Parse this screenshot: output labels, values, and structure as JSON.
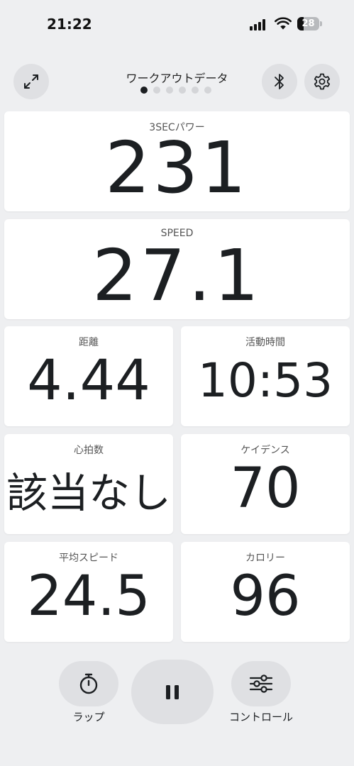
{
  "status_bar": {
    "time": "21:22",
    "battery_level": "28",
    "battery_fraction": 0.28
  },
  "header": {
    "title": "ワークアウトデータ",
    "page_count": 6,
    "active_page": 0,
    "left_icon": "expand-arrows-icon",
    "right_icons": [
      "bluetooth-icon",
      "gear-icon"
    ]
  },
  "metrics": {
    "power": {
      "label": "3SECパワー",
      "value": "231"
    },
    "speed": {
      "label": "SPEED",
      "value": "27.1"
    },
    "distance": {
      "label": "距離",
      "value": "4.44"
    },
    "duration": {
      "label": "活動時間",
      "value": "10:53"
    },
    "heart_rate": {
      "label": "心拍数",
      "value": "該当なし"
    },
    "cadence": {
      "label": "ケイデンス",
      "value": "70"
    },
    "avg_speed": {
      "label": "平均スピード",
      "value": "24.5"
    },
    "calories": {
      "label": "カロリー",
      "value": "96"
    }
  },
  "controls": {
    "lap_label": "ラップ",
    "lap_icon": "stopwatch-icon",
    "pause_icon": "pause-icon",
    "control_label": "コントロール",
    "control_icon": "sliders-icon"
  },
  "colors": {
    "background": "#eeeff1",
    "tile": "#ffffff",
    "button": "#dfe0e3",
    "text": "#1c1f22",
    "active_dot": "#1c1f22",
    "inactive_dot": "#d4d5d8"
  }
}
